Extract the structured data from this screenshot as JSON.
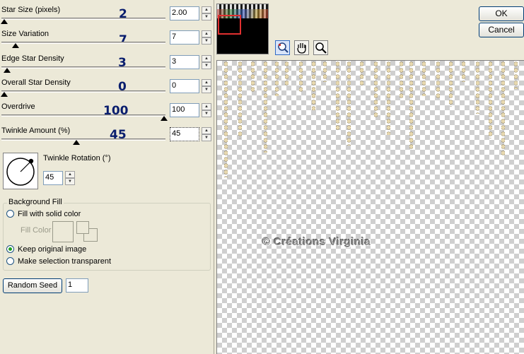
{
  "sliders": [
    {
      "label": "Star Size (pixels)",
      "big": "2",
      "value": "2.00"
    },
    {
      "label": "Size Variation",
      "big": "7",
      "value": "7"
    },
    {
      "label": "Edge Star Density",
      "big": "3",
      "value": "3"
    },
    {
      "label": "Overall Star Density",
      "big": "0",
      "value": "0"
    },
    {
      "label": "Overdrive",
      "big": "100",
      "value": "100"
    },
    {
      "label": "Twinkle Amount (%)",
      "big": "45",
      "value": "45"
    }
  ],
  "rotation": {
    "label": "Twinkle Rotation (°)",
    "value": "45"
  },
  "background_fill": {
    "title": "Background Fill",
    "fill_solid": "Fill with solid color",
    "fill_color_label": "Fill Color",
    "keep_original": "Keep original image",
    "make_transparent": "Make selection transparent"
  },
  "random_seed": {
    "label": "Random Seed",
    "value": "1"
  },
  "buttons": {
    "ok": "OK",
    "cancel": "Cancel"
  },
  "watermark": "© Créations Virginia",
  "colors": {
    "accent_red": "#e03030",
    "big_number": "#0a1e6e"
  },
  "icons": [
    "zoom-fit-icon",
    "hand-pan-icon",
    "magnifier-icon"
  ]
}
